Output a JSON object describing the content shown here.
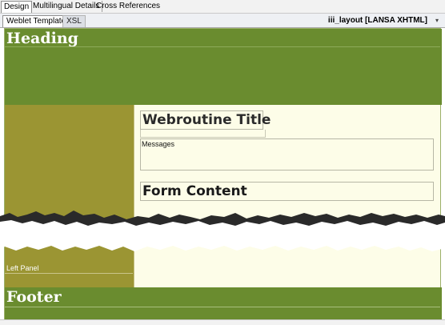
{
  "top_tabs": [
    {
      "label": "Design",
      "active": true
    },
    {
      "label": "Multilingual Details",
      "active": false
    },
    {
      "label": "Cross References",
      "active": false
    }
  ],
  "sub_tabs": [
    {
      "label": "Weblet Template",
      "active": true
    },
    {
      "label": "XSL",
      "active": false
    }
  ],
  "layout_selector": {
    "value": "iii_layout [LANSA XHTML]",
    "icon": "chevron-down-icon"
  },
  "page": {
    "heading": "Heading",
    "webroutine_title": "Webroutine Title",
    "messages_label": "Messages",
    "form_content": "Form Content",
    "left_panel": "Left Panel",
    "footer": "Footer"
  },
  "colors": {
    "heading_green": "#6a8c2f",
    "left_panel_olive": "#9b9533",
    "content_cream": "#fdfde8"
  }
}
